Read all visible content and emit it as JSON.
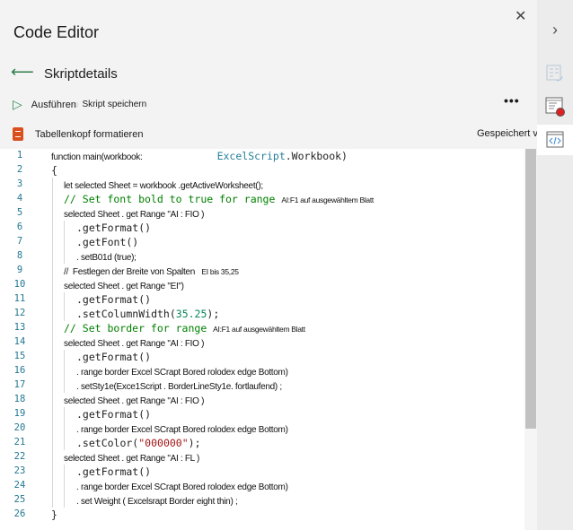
{
  "header": {
    "title": "Code Editor",
    "close_icon": "close-icon"
  },
  "nav": {
    "back_icon": "arrow-left-icon",
    "subtitle": "Skriptdetails"
  },
  "toolbar": {
    "run_label": "Ausführen",
    "save_label": "Skript speichern",
    "more_label": "•••"
  },
  "script": {
    "name": "Tabellenkopf formatieren",
    "status": "Gespeichert v"
  },
  "colors": {
    "accent": "#2e8b57",
    "script_icon": "#d94f1e",
    "line_number": "#237893",
    "comment": "#008000"
  },
  "code": {
    "lines": [
      {
        "n": "1",
        "i": 0,
        "segs": [
          {
            "c": "sans",
            "t": "function main(workbook:"
          },
          {
            "c": "sp",
            "t": "            "
          },
          {
            "c": "type",
            "t": "ExcelScript"
          },
          {
            "c": "mono",
            "t": ".Workbook)"
          }
        ]
      },
      {
        "n": "2",
        "i": 0,
        "segs": [
          {
            "c": "mono",
            "t": "{"
          }
        ]
      },
      {
        "n": "3",
        "i": 1,
        "segs": [
          {
            "c": "sans",
            "t": "let selected Sheet = workbook .getActiveWorksheet();"
          }
        ]
      },
      {
        "n": "4",
        "i": 1,
        "segs": [
          {
            "c": "comment",
            "t": "// Set font bold to true for range "
          },
          {
            "c": "small",
            "t": "AI:F1 auf ausgewähltem Blatt"
          }
        ]
      },
      {
        "n": "5",
        "i": 1,
        "segs": [
          {
            "c": "sans",
            "t": "selected Sheet . get Range \"AI : FIO )"
          }
        ]
      },
      {
        "n": "6",
        "i": 2,
        "segs": [
          {
            "c": "mono",
            "t": ".getFormat()"
          }
        ]
      },
      {
        "n": "7",
        "i": 2,
        "segs": [
          {
            "c": "mono",
            "t": ".getFont()"
          }
        ]
      },
      {
        "n": "8",
        "i": 2,
        "segs": [
          {
            "c": "sans",
            "t": ". setB01d (true);"
          }
        ]
      },
      {
        "n": "9",
        "i": 1,
        "segs": [
          {
            "c": "sans",
            "t": "//  Festlegen der Breite von Spalten   "
          },
          {
            "c": "small",
            "t": "EI bis 35,25"
          }
        ]
      },
      {
        "n": "10",
        "i": 1,
        "segs": [
          {
            "c": "sans",
            "t": "selected Sheet . get Range \"EI\")"
          }
        ]
      },
      {
        "n": "11",
        "i": 2,
        "segs": [
          {
            "c": "mono",
            "t": ".getFormat()"
          }
        ]
      },
      {
        "n": "12",
        "i": 2,
        "segs": [
          {
            "c": "mono",
            "t": ".setColumnWidth("
          },
          {
            "c": "num",
            "t": "35.25"
          },
          {
            "c": "mono",
            "t": ");"
          }
        ]
      },
      {
        "n": "13",
        "i": 1,
        "segs": [
          {
            "c": "comment",
            "t": "// Set border for range "
          },
          {
            "c": "small",
            "t": "AI:F1 auf ausgewähltem Blatt"
          }
        ]
      },
      {
        "n": "14",
        "i": 1,
        "segs": [
          {
            "c": "sans",
            "t": "selected Sheet . get Range \"AI : FIO )"
          }
        ]
      },
      {
        "n": "15",
        "i": 2,
        "segs": [
          {
            "c": "mono",
            "t": ".getFormat()"
          }
        ]
      },
      {
        "n": "16",
        "i": 2,
        "segs": [
          {
            "c": "sans",
            "t": ". range border Excel SCrapt Bored rolodex edge Bottom)"
          }
        ]
      },
      {
        "n": "17",
        "i": 2,
        "segs": [
          {
            "c": "sans",
            "t": ". setSty1e(Exce1Script . BorderLineSty1e. fortlaufend) ;"
          }
        ]
      },
      {
        "n": "18",
        "i": 1,
        "segs": [
          {
            "c": "sans",
            "t": "selected Sheet . get Range \"AI : FIO )"
          }
        ]
      },
      {
        "n": "19",
        "i": 2,
        "segs": [
          {
            "c": "mono",
            "t": ".getFormat()"
          }
        ]
      },
      {
        "n": "20",
        "i": 2,
        "segs": [
          {
            "c": "sans",
            "t": ". range border Excel SCrapt Bored rolodex edge Bottom)"
          }
        ]
      },
      {
        "n": "21",
        "i": 2,
        "segs": [
          {
            "c": "mono",
            "t": ".setColor("
          },
          {
            "c": "str",
            "t": "\"000000\""
          },
          {
            "c": "mono",
            "t": ");"
          }
        ]
      },
      {
        "n": "22",
        "i": 1,
        "segs": [
          {
            "c": "sans",
            "t": "selected Sheet . get Range \"AI : FL )"
          }
        ]
      },
      {
        "n": "23",
        "i": 2,
        "segs": [
          {
            "c": "mono",
            "t": ".getFormat()"
          }
        ]
      },
      {
        "n": "24",
        "i": 2,
        "segs": [
          {
            "c": "sans",
            "t": ". range border Excel SCrapt Bored rolodex edge Bottom)"
          }
        ]
      },
      {
        "n": "25",
        "i": 2,
        "segs": [
          {
            "c": "sans",
            "t": ". set Weight ( Excelsrapt Border eight thin) ;"
          }
        ]
      },
      {
        "n": "26",
        "i": 0,
        "segs": [
          {
            "c": "mono",
            "t": "}"
          }
        ]
      }
    ]
  },
  "rail": {
    "items": [
      "chevron-right-icon",
      "table-refresh-icon",
      "record-script-icon",
      "code-editor-icon"
    ]
  }
}
